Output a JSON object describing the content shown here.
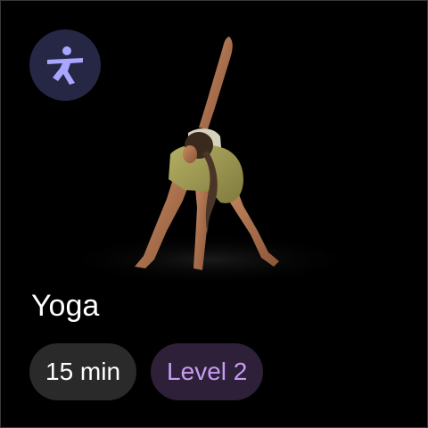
{
  "card": {
    "title": "Yoga",
    "duration": "15 min",
    "level": "Level 2"
  },
  "icons": {
    "activity": "yoga-pose-icon"
  },
  "colors": {
    "background": "#000000",
    "badge_background": "#262645",
    "badge_icon": "#a8a6ff",
    "duration_chip_background": "#2a2a2a",
    "level_chip_background": "#2d2038",
    "level_chip_text": "#c79cf0"
  }
}
